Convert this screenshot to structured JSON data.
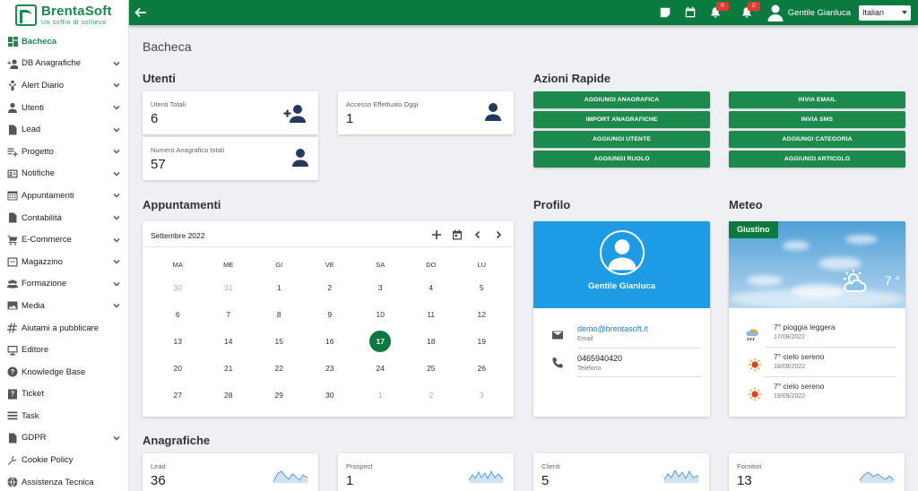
{
  "brand": {
    "title": "BrentaSoft",
    "subtitle": "Un soffio di sollievo"
  },
  "sidebar": {
    "items": [
      {
        "label": "Bacheca",
        "icon": "dashboard-icon",
        "active": true,
        "chevron": false
      },
      {
        "label": "DB Anagrafiche",
        "icon": "person-add-icon",
        "chevron": true
      },
      {
        "label": "Alert Diario",
        "icon": "alert-person-icon",
        "chevron": true
      },
      {
        "label": "Utenti",
        "icon": "person-icon",
        "chevron": true
      },
      {
        "label": "Lead",
        "icon": "document-icon",
        "chevron": true
      },
      {
        "label": "Progetto",
        "icon": "playlist-add-icon",
        "chevron": true
      },
      {
        "label": "Notifiche",
        "icon": "contact-card-icon",
        "chevron": true
      },
      {
        "label": "Appuntamenti",
        "icon": "calendar-grid-icon",
        "chevron": true
      },
      {
        "label": "Contabilità",
        "icon": "document-icon",
        "chevron": true
      },
      {
        "label": "E-Commerce",
        "icon": "cart-icon",
        "chevron": true
      },
      {
        "label": "Magazzino",
        "icon": "warehouse-icon",
        "chevron": true
      },
      {
        "label": "Formazione",
        "icon": "group-icon",
        "chevron": true
      },
      {
        "label": "Media",
        "icon": "image-icon",
        "chevron": true
      },
      {
        "label": "Aiutami a pubblicare",
        "icon": "hashtag-icon",
        "chevron": false
      },
      {
        "label": "Editore",
        "icon": "monitor-icon",
        "chevron": false
      },
      {
        "label": "Knowledge Base",
        "icon": "help-circle-icon",
        "chevron": false
      },
      {
        "label": "Ticket",
        "icon": "help-box-icon",
        "chevron": false
      },
      {
        "label": "Task",
        "icon": "list-icon",
        "chevron": false
      },
      {
        "label": "GDPR",
        "icon": "document-icon",
        "chevron": true
      },
      {
        "label": "Cookie Policy",
        "icon": "tools-icon",
        "chevron": false
      },
      {
        "label": "Assistenza Tecnica",
        "icon": "globe-icon",
        "chevron": false
      }
    ]
  },
  "topbar": {
    "badge1": "0",
    "badge2": "0",
    "username": "Gentile Gianluca",
    "language": "Italian"
  },
  "page": {
    "title": "Bacheca"
  },
  "utenti": {
    "title": "Utenti",
    "cards": [
      {
        "label": "Utenti Totali",
        "value": "6"
      },
      {
        "label": "Accesso Effettuato Oggi",
        "value": "1"
      },
      {
        "label": "Numero Anagrafica totali",
        "value": "57"
      }
    ]
  },
  "azioni": {
    "title": "Azioni Rapide",
    "left": [
      "AGGIUNGI ANAGRAFICA",
      "IMPORT ANAGRAFICHE",
      "AGGIUNGI UTENTE",
      "AGGIUNGI RUOLO"
    ],
    "right": [
      "INVIA EMAIL",
      "INVIA SMS",
      "AGGIUNGI CATEGORIA",
      "AGGIUNGI ARTICOLO"
    ]
  },
  "appuntamenti": {
    "title": "Appuntamenti",
    "month": "Settembre 2022",
    "dow": [
      "MA",
      "ME",
      "GI",
      "VE",
      "SA",
      "DO",
      "LU"
    ],
    "weeks": [
      [
        [
          "30",
          true
        ],
        [
          "31",
          true
        ],
        [
          "1",
          false
        ],
        [
          "2",
          false
        ],
        [
          "3",
          false
        ],
        [
          "4",
          false
        ],
        [
          "5",
          false
        ]
      ],
      [
        [
          "6",
          false
        ],
        [
          "7",
          false
        ],
        [
          "8",
          false
        ],
        [
          "9",
          false
        ],
        [
          "10",
          false
        ],
        [
          "11",
          false
        ],
        [
          "12",
          false
        ]
      ],
      [
        [
          "13",
          false
        ],
        [
          "14",
          false
        ],
        [
          "15",
          false
        ],
        [
          "16",
          false
        ],
        [
          "17",
          false
        ],
        [
          "18",
          false
        ],
        [
          "19",
          false
        ]
      ],
      [
        [
          "20",
          false
        ],
        [
          "21",
          false
        ],
        [
          "22",
          false
        ],
        [
          "23",
          false
        ],
        [
          "24",
          false
        ],
        [
          "25",
          false
        ],
        [
          "26",
          false
        ]
      ],
      [
        [
          "27",
          false
        ],
        [
          "28",
          false
        ],
        [
          "29",
          false
        ],
        [
          "30",
          false
        ],
        [
          "1",
          true
        ],
        [
          "2",
          true
        ],
        [
          "3",
          true
        ]
      ]
    ],
    "today": "17"
  },
  "profilo": {
    "title": "Profilo",
    "name": "Gentile Gianluca",
    "email": "demo@brentasoft.it",
    "email_label": "Email",
    "phone": "0465940420",
    "phone_label": "Telefono"
  },
  "meteo": {
    "title": "Meteo",
    "place": "Giustino",
    "temp": "7 °",
    "forecast": [
      {
        "desc": "7° pioggia leggera",
        "date": "17/09/2022",
        "icon": "rain-icon"
      },
      {
        "desc": "7° cielo sereno",
        "date": "18/09/2022",
        "icon": "sun-icon"
      },
      {
        "desc": "7° cielo sereno",
        "date": "19/09/2022",
        "icon": "sun-icon"
      }
    ]
  },
  "anagrafiche": {
    "title": "Anagrafiche",
    "cards": [
      {
        "label": "Lead",
        "value": "36"
      },
      {
        "label": "Prospect",
        "value": "1"
      },
      {
        "label": "Clienti",
        "value": "5"
      },
      {
        "label": "Fornitori",
        "value": "13"
      }
    ]
  },
  "colors": {
    "primary": "#0b7a3e",
    "accent": "#1d8a4d",
    "profile": "#1e9be5",
    "badge": "#e53935"
  }
}
